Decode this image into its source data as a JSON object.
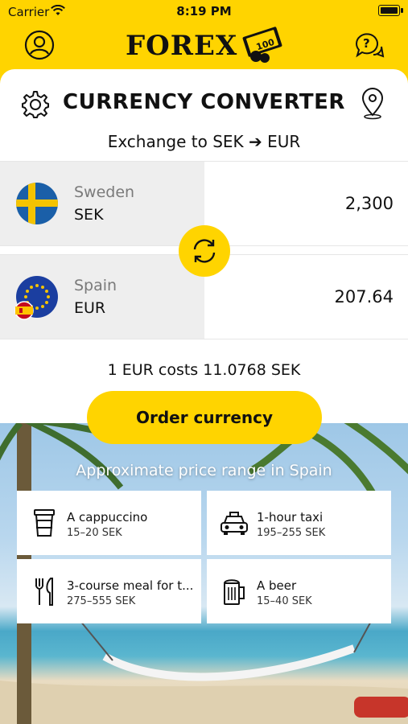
{
  "status_bar": {
    "carrier": "Carrier",
    "time": "8:19 PM"
  },
  "header": {
    "logo_text": "FOREX"
  },
  "converter": {
    "title": "CURRENCY CONVERTER",
    "subtitle": "Exchange to SEK ➔ EUR",
    "from": {
      "country": "Sweden",
      "code": "SEK",
      "amount": "2,300"
    },
    "to": {
      "country": "Spain",
      "code": "EUR",
      "amount": "207.64"
    },
    "rate_text": "1 EUR costs 11.0768 SEK"
  },
  "order_button": "Order currency",
  "price_range": {
    "heading": "Approximate price range in Spain",
    "items": [
      {
        "label": "A cappuccino",
        "price": "15–20 SEK",
        "icon": "coffee-cup-icon"
      },
      {
        "label": "1-hour taxi",
        "price": "195–255 SEK",
        "icon": "taxi-icon"
      },
      {
        "label": "3-course meal for t...",
        "price": "275–555 SEK",
        "icon": "fork-knife-icon"
      },
      {
        "label": "A beer",
        "price": "15–40 SEK",
        "icon": "beer-mug-icon"
      }
    ]
  },
  "colors": {
    "accent": "#FFD400",
    "panel": "#eeeeee"
  }
}
